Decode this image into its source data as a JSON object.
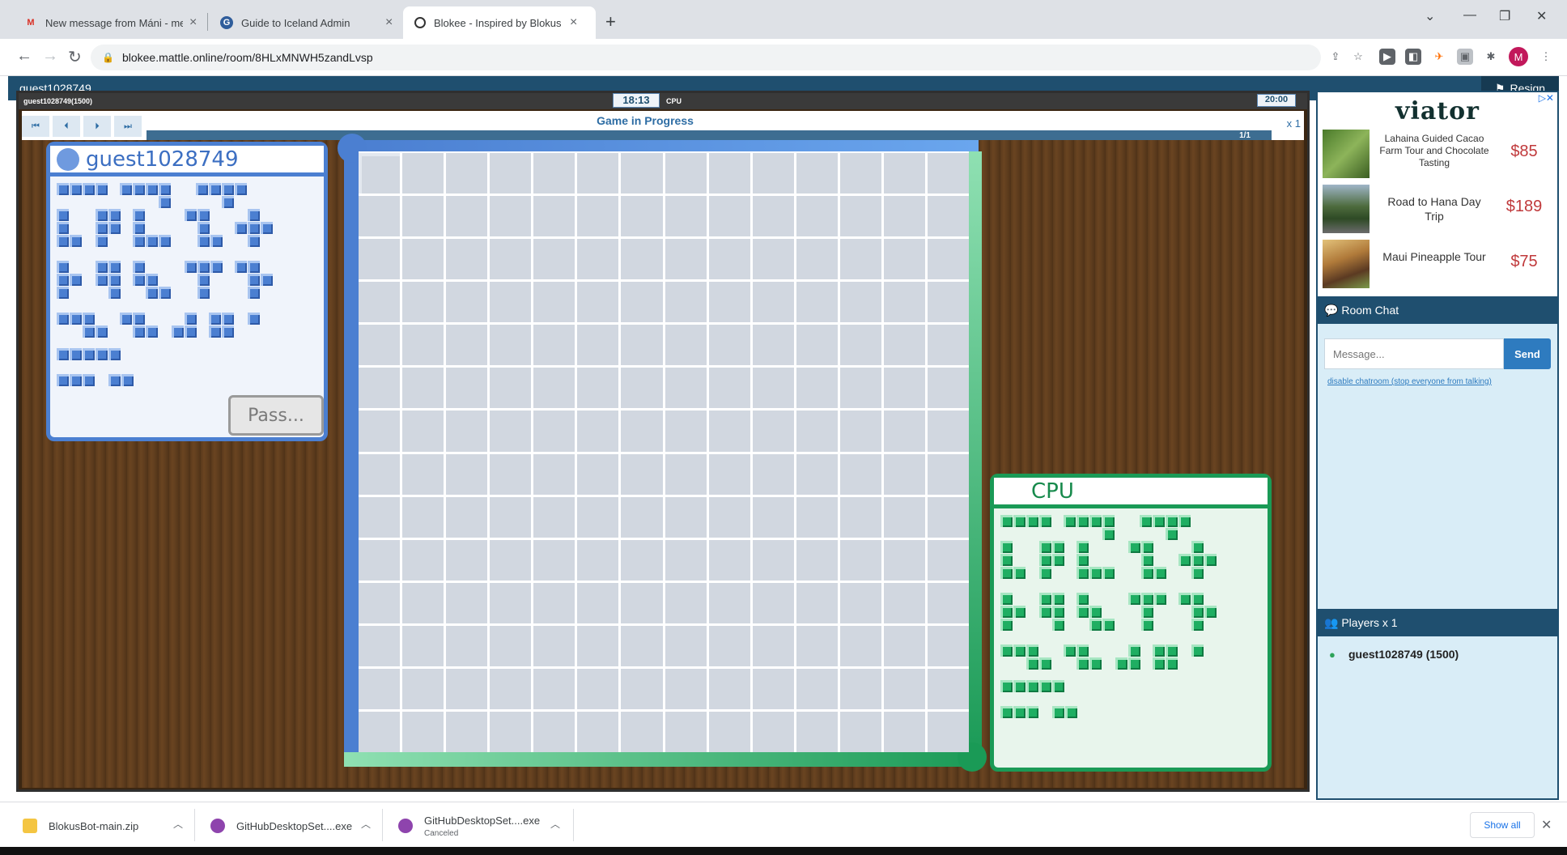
{
  "browser": {
    "tabs": [
      {
        "title": "New message from Máni - melo",
        "icon": "gmail-icon"
      },
      {
        "title": "Guide to Iceland Admin",
        "icon": "guide-icon"
      },
      {
        "title": "Blokee - Inspired by Blokus - Onl",
        "icon": "blokee-icon",
        "active": true
      }
    ],
    "url": "blokee.mattle.online/room/8HLxMNWH5zandLvsp",
    "profile_initial": "M"
  },
  "topbar": {
    "username": "guest1028749",
    "resign_label": "Resign"
  },
  "game": {
    "player1_label": "guest1028749(1500)",
    "timer1": "18:13",
    "player2_label": "CPU",
    "timer2": "20:00",
    "status": "Game in Progress",
    "progress_text": "1/1",
    "progress": 1.0,
    "speed": "x 1",
    "board_size": 14
  },
  "panels": {
    "blue": {
      "name": "guest1028749",
      "pass_label": "Pass...",
      "color": "#4b7fd1"
    },
    "green": {
      "name": "CPU",
      "color": "#1a9a56"
    }
  },
  "ad": {
    "brand": "viator",
    "items": [
      {
        "name": "Lahaina Guided Cacao Farm Tour and Chocolate Tasting",
        "price": "$85"
      },
      {
        "name": "Road to Hana Day Trip",
        "price": "$189"
      },
      {
        "name": "Maui Pineapple Tour",
        "price": "$75"
      }
    ]
  },
  "chat": {
    "title": "Room Chat",
    "placeholder": "Message...",
    "send_label": "Send",
    "disable_link": "disable chatroom (stop everyone from talking)"
  },
  "players": {
    "title": "Players x 1",
    "list": [
      {
        "name": "guest1028749 (1500)"
      }
    ]
  },
  "downloads": [
    {
      "name": "BlokusBot-main.zip",
      "status": ""
    },
    {
      "name": "GitHubDesktopSet....exe",
      "status": ""
    },
    {
      "name": "GitHubDesktopSet....exe",
      "status": "Canceled"
    }
  ],
  "download_bar": {
    "show_all": "Show all"
  }
}
